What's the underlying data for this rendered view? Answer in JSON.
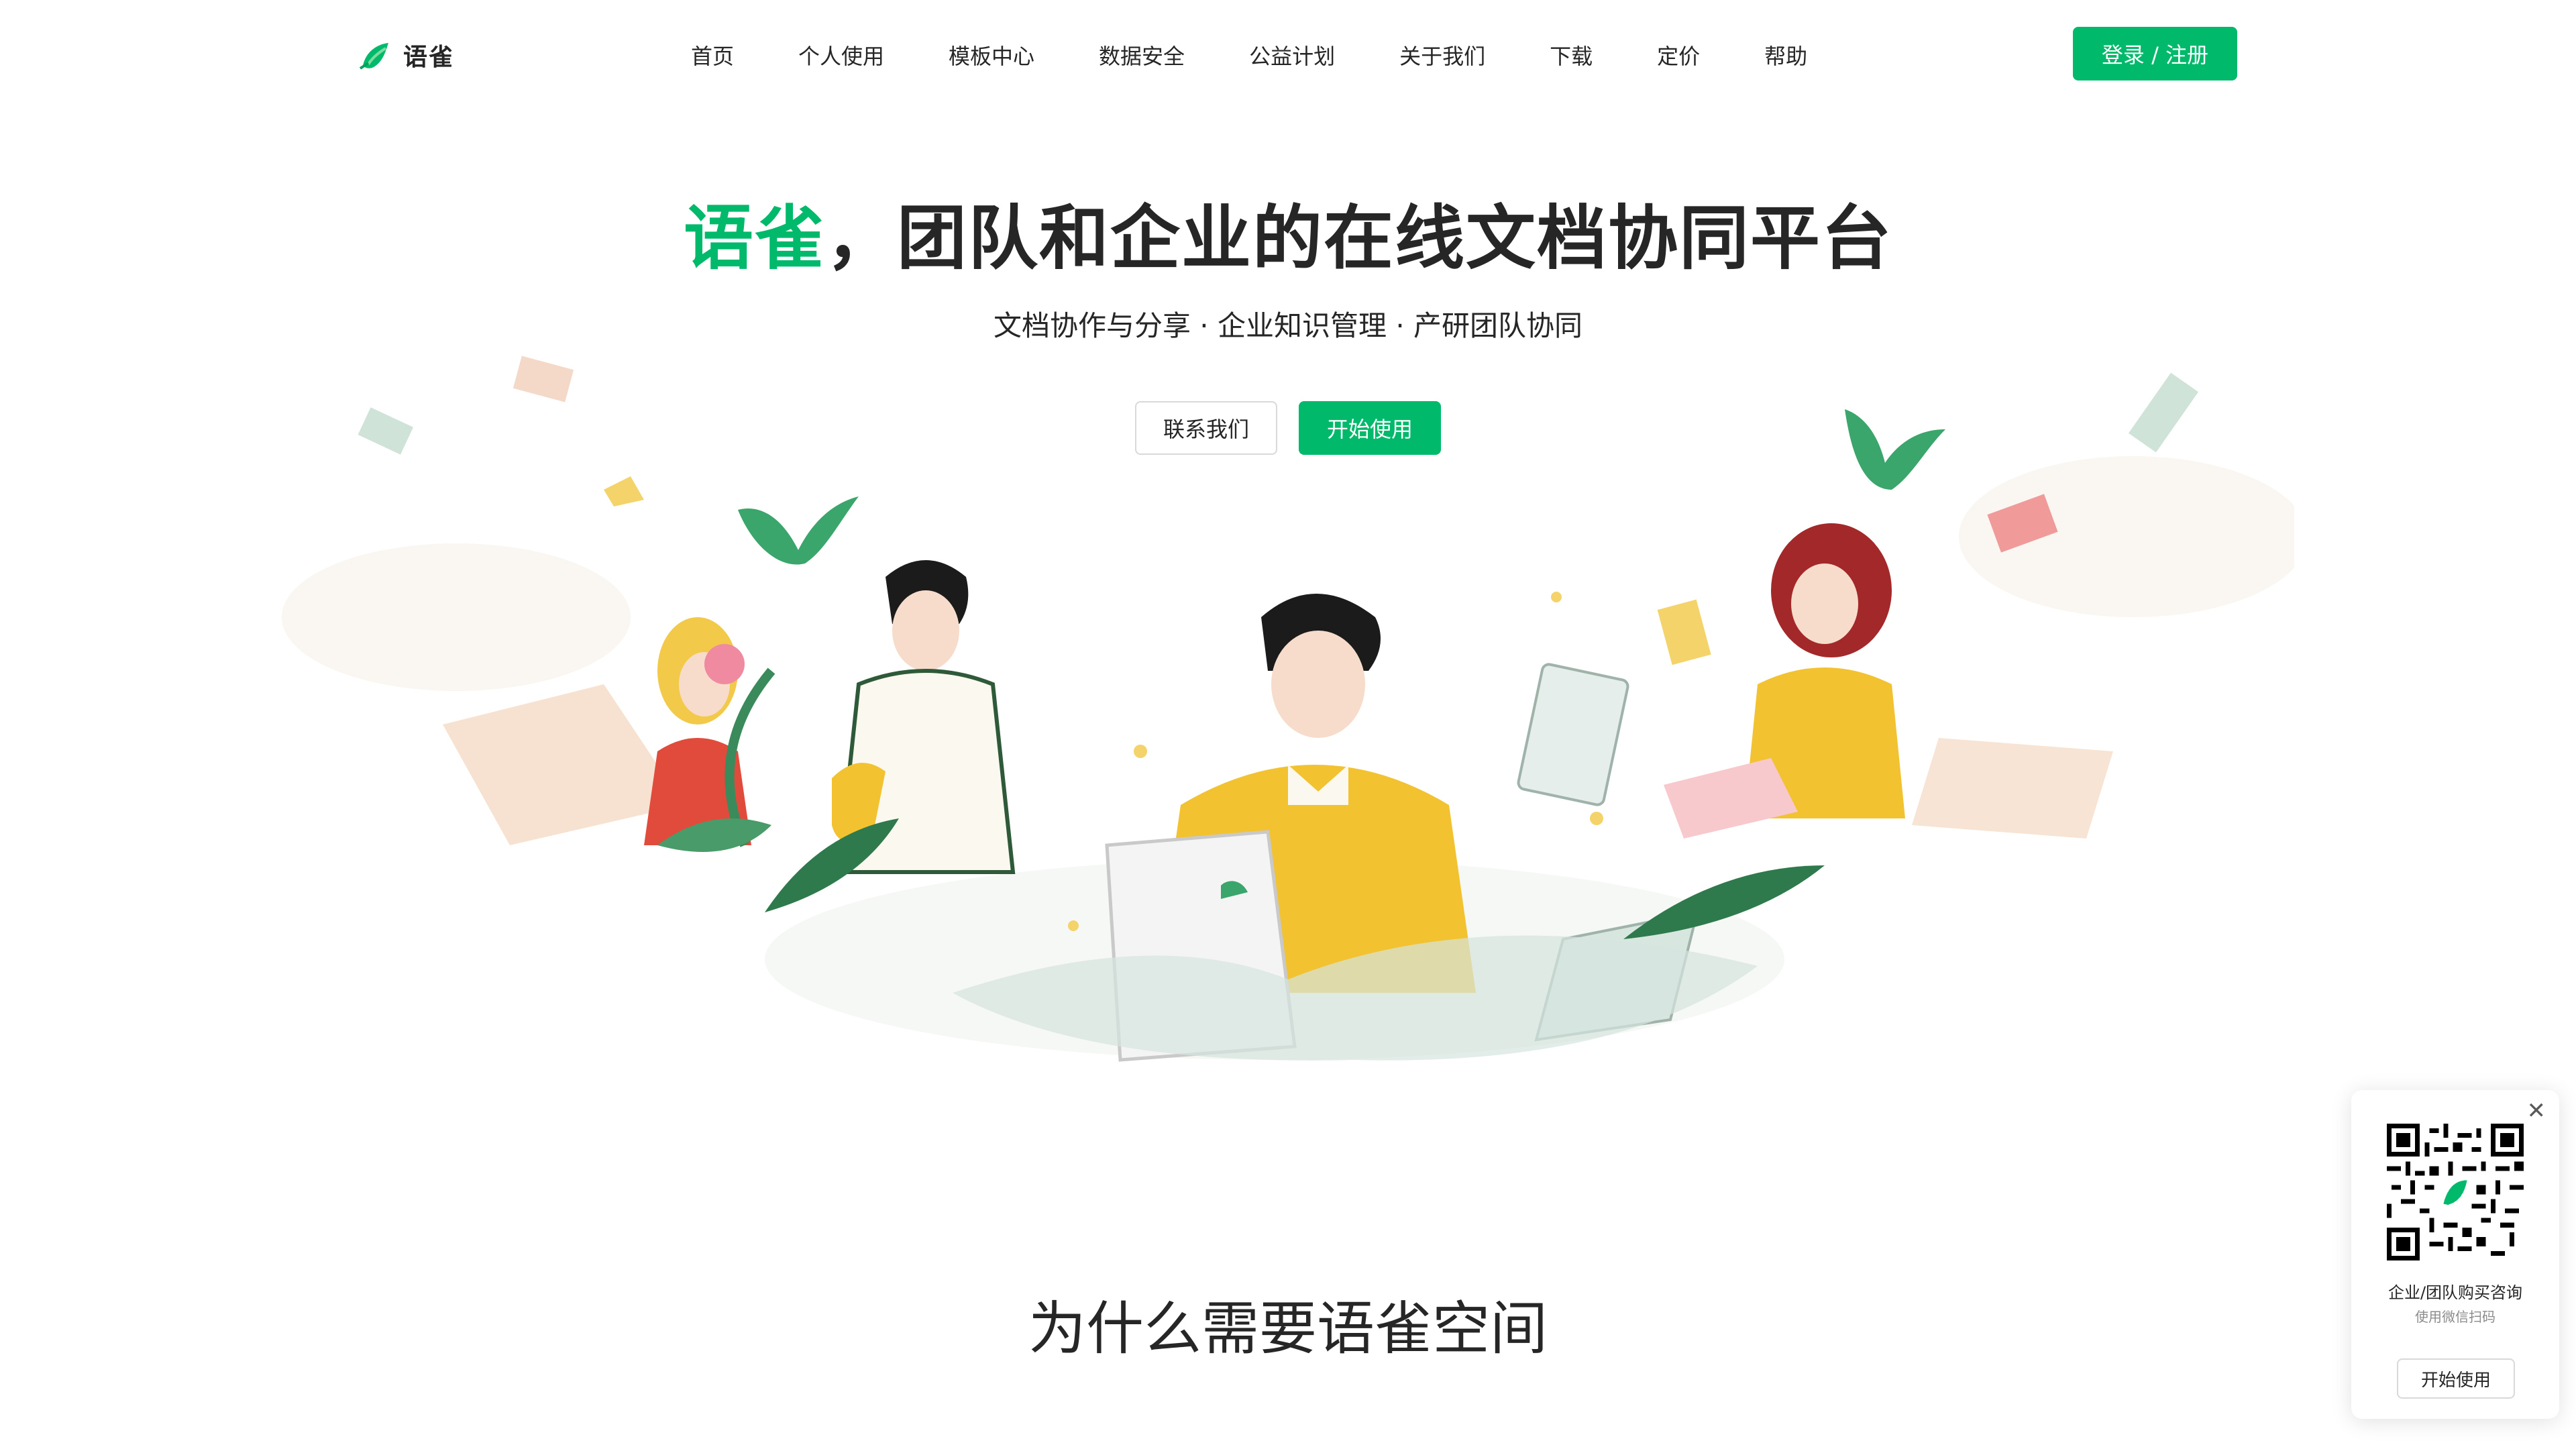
{
  "header": {
    "logo_text": "语雀",
    "nav": [
      "首页",
      "个人使用",
      "模板中心",
      "数据安全",
      "公益计划",
      "关于我们",
      "下载",
      "定价",
      "帮助"
    ],
    "login_label": "登录 / 注册"
  },
  "hero": {
    "title_brand": "语雀",
    "title_rest": "，团队和企业的在线文档协同平台",
    "subtitle": "文档协作与分享 · 企业知识管理 · 产研团队协同",
    "contact_label": "联系我们",
    "start_label": "开始使用"
  },
  "section": {
    "title": "为什么需要语雀空间"
  },
  "qr_card": {
    "close_icon": "close-icon",
    "title": "企业/团队购买咨询",
    "subtitle": "使用微信扫码",
    "button_label": "开始使用"
  },
  "colors": {
    "brand": "#00b96b",
    "text": "#262626",
    "muted": "#8c8c8c"
  }
}
